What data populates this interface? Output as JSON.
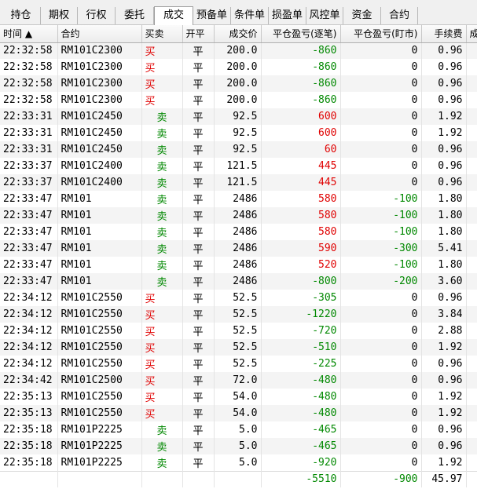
{
  "tabs": [
    "持仓",
    "期权",
    "行权",
    "委托",
    "成交",
    "预备单",
    "条件单",
    "损盈单",
    "风控单",
    "资金",
    "合约"
  ],
  "active_tab": "成交",
  "columns": [
    "时间",
    "合约",
    "买卖",
    "开平",
    "成交价",
    "平仓盈亏(逐笔)",
    "平仓盈亏(盯市)",
    "手续费",
    "成"
  ],
  "sort_indicator": "▲",
  "colors": {
    "buy": "#e00000",
    "sell": "#008800",
    "profit": "#e00000",
    "loss": "#008800"
  },
  "rows": [
    [
      "22:32:58",
      "RM101C2300",
      "买",
      "平",
      "200.0",
      "-860",
      "0",
      "0.96"
    ],
    [
      "22:32:58",
      "RM101C2300",
      "买",
      "平",
      "200.0",
      "-860",
      "0",
      "0.96"
    ],
    [
      "22:32:58",
      "RM101C2300",
      "买",
      "平",
      "200.0",
      "-860",
      "0",
      "0.96"
    ],
    [
      "22:32:58",
      "RM101C2300",
      "买",
      "平",
      "200.0",
      "-860",
      "0",
      "0.96"
    ],
    [
      "22:33:31",
      "RM101C2450",
      "卖",
      "平",
      "92.5",
      "600",
      "0",
      "1.92"
    ],
    [
      "22:33:31",
      "RM101C2450",
      "卖",
      "平",
      "92.5",
      "600",
      "0",
      "1.92"
    ],
    [
      "22:33:31",
      "RM101C2450",
      "卖",
      "平",
      "92.5",
      "60",
      "0",
      "0.96"
    ],
    [
      "22:33:37",
      "RM101C2400",
      "卖",
      "平",
      "121.5",
      "445",
      "0",
      "0.96"
    ],
    [
      "22:33:37",
      "RM101C2400",
      "卖",
      "平",
      "121.5",
      "445",
      "0",
      "0.96"
    ],
    [
      "22:33:47",
      "RM101",
      "卖",
      "平",
      "2486",
      "580",
      "-100",
      "1.80"
    ],
    [
      "22:33:47",
      "RM101",
      "卖",
      "平",
      "2486",
      "580",
      "-100",
      "1.80"
    ],
    [
      "22:33:47",
      "RM101",
      "卖",
      "平",
      "2486",
      "580",
      "-100",
      "1.80"
    ],
    [
      "22:33:47",
      "RM101",
      "卖",
      "平",
      "2486",
      "590",
      "-300",
      "5.41"
    ],
    [
      "22:33:47",
      "RM101",
      "卖",
      "平",
      "2486",
      "520",
      "-100",
      "1.80"
    ],
    [
      "22:33:47",
      "RM101",
      "卖",
      "平",
      "2486",
      "-800",
      "-200",
      "3.60"
    ],
    [
      "22:34:12",
      "RM101C2550",
      "买",
      "平",
      "52.5",
      "-305",
      "0",
      "0.96"
    ],
    [
      "22:34:12",
      "RM101C2550",
      "买",
      "平",
      "52.5",
      "-1220",
      "0",
      "3.84"
    ],
    [
      "22:34:12",
      "RM101C2550",
      "买",
      "平",
      "52.5",
      "-720",
      "0",
      "2.88"
    ],
    [
      "22:34:12",
      "RM101C2550",
      "买",
      "平",
      "52.5",
      "-510",
      "0",
      "1.92"
    ],
    [
      "22:34:12",
      "RM101C2550",
      "买",
      "平",
      "52.5",
      "-225",
      "0",
      "0.96"
    ],
    [
      "22:34:42",
      "RM101C2500",
      "买",
      "平",
      "72.0",
      "-480",
      "0",
      "0.96"
    ],
    [
      "22:35:13",
      "RM101C2550",
      "买",
      "平",
      "54.0",
      "-480",
      "0",
      "1.92"
    ],
    [
      "22:35:13",
      "RM101C2550",
      "买",
      "平",
      "54.0",
      "-480",
      "0",
      "1.92"
    ],
    [
      "22:35:18",
      "RM101P2225",
      "卖",
      "平",
      "5.0",
      "-465",
      "0",
      "0.96"
    ],
    [
      "22:35:18",
      "RM101P2225",
      "卖",
      "平",
      "5.0",
      "-465",
      "0",
      "0.96"
    ],
    [
      "22:35:18",
      "RM101P2225",
      "卖",
      "平",
      "5.0",
      "-920",
      "0",
      "1.92"
    ]
  ],
  "totals": {
    "pnl_trade": "-5510",
    "pnl_mtm": "-900",
    "fee": "45.97"
  }
}
